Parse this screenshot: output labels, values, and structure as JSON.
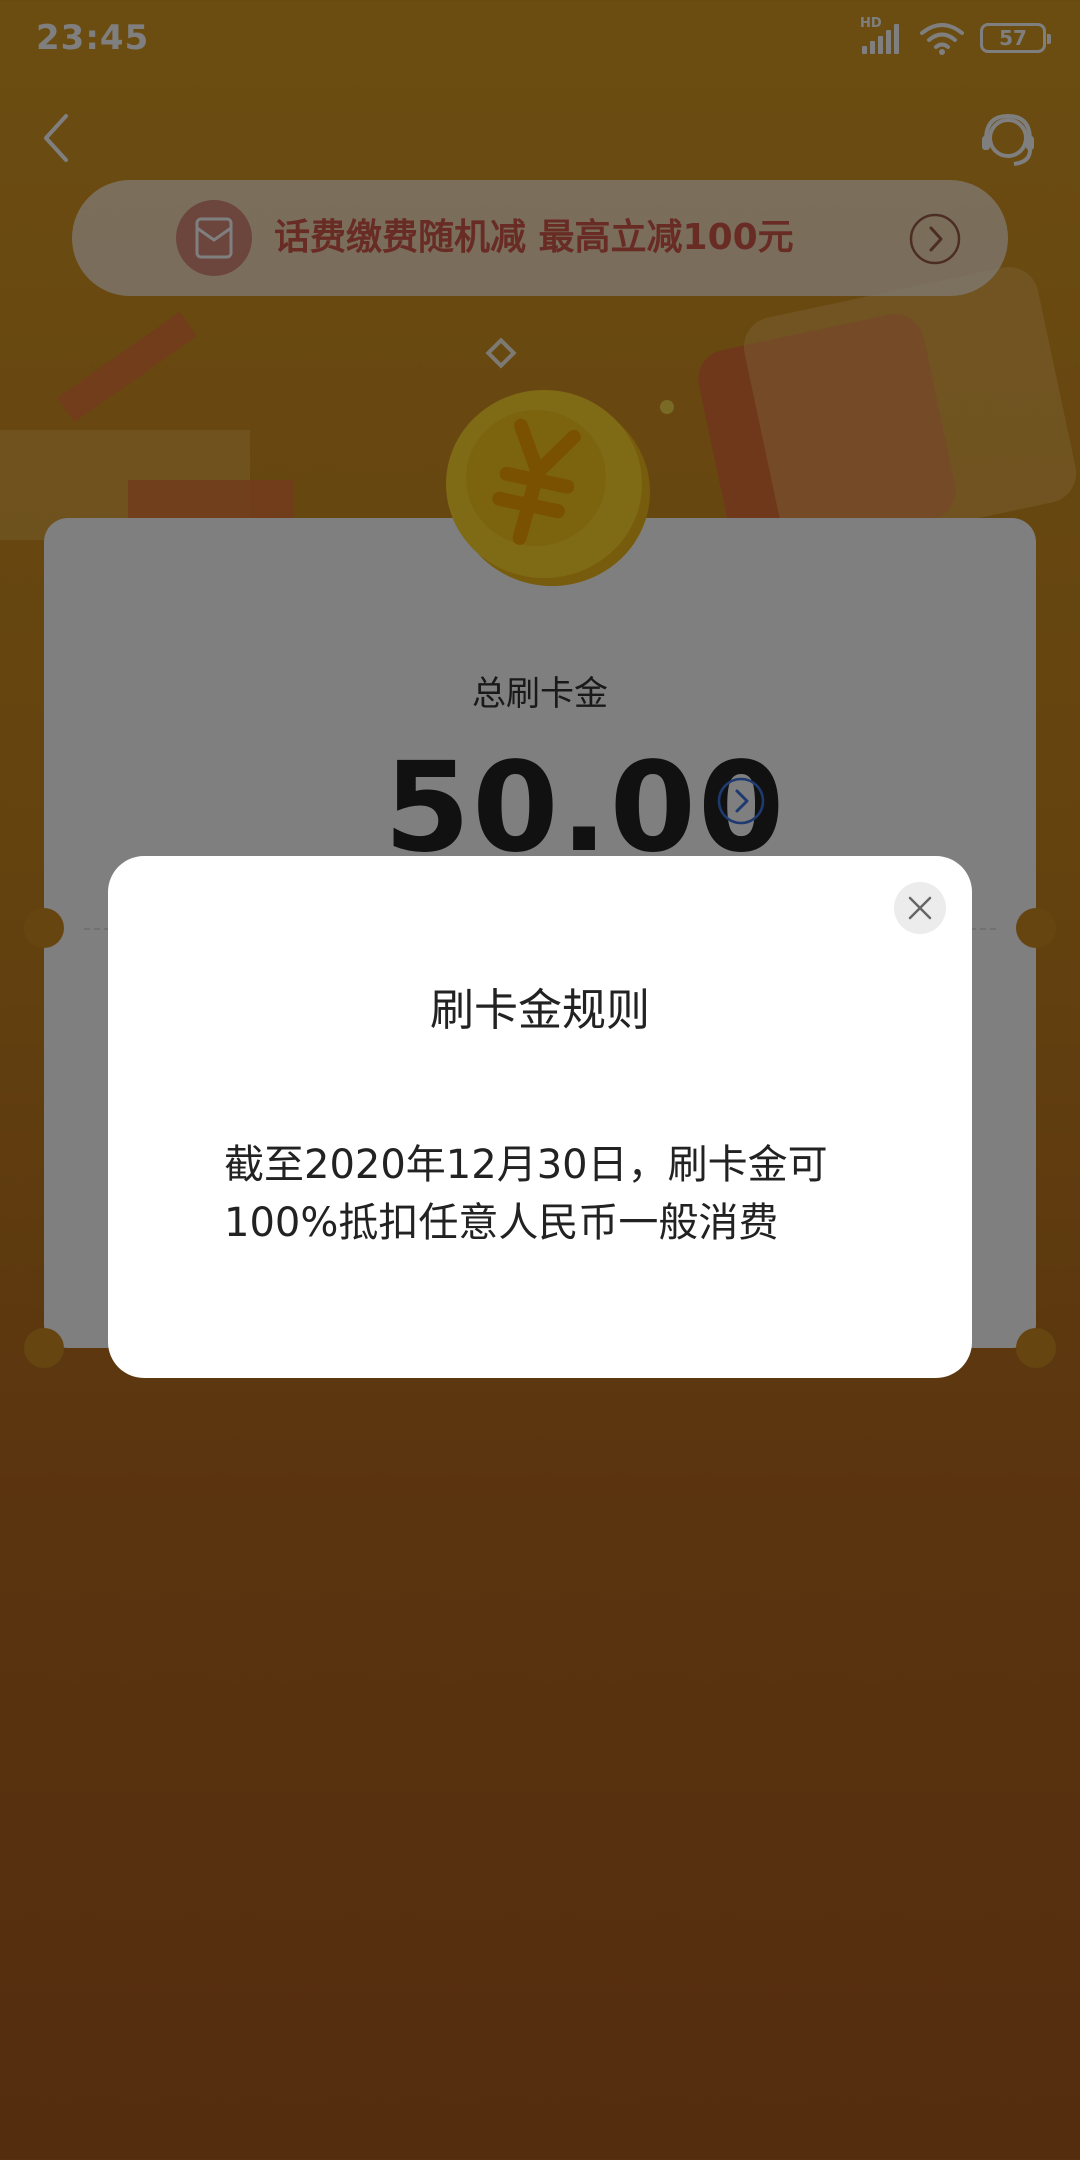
{
  "status_bar": {
    "time": "23:45",
    "network_label": "HD",
    "battery": "57"
  },
  "header": {
    "back_icon": "chevron-left-icon",
    "service_icon": "customer-service-icon"
  },
  "promo_banner": {
    "text": "话费缴费随机减 最高立减100元",
    "icon": "red-envelope-icon",
    "arrow_icon": "chevron-right-circle-icon"
  },
  "card": {
    "title": "总刷卡金",
    "amount": "50.00",
    "arrow_icon": "chevron-right-circle-icon"
  },
  "modal": {
    "title": "刷卡金规则",
    "body_line1": "截至2020年12月30日，刷卡金可",
    "body_line2": "100%抵扣任意人民币一般消费",
    "close_icon": "close-icon"
  },
  "colors": {
    "background_top": "#d79a23",
    "background_bottom": "#a85a1e",
    "promo_text": "#d2584a",
    "accent_blue": "#3d74e0"
  }
}
